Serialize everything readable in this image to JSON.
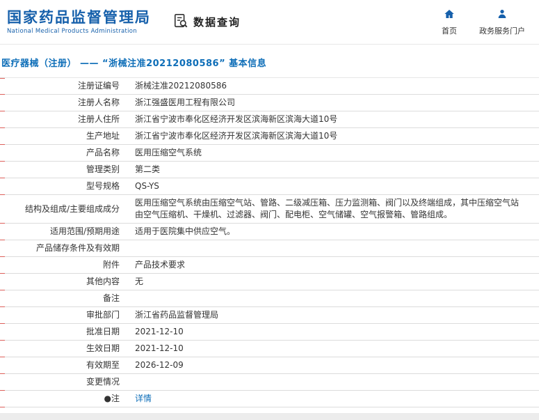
{
  "colors": {
    "brand_blue": "#1660ab",
    "title_blue": "#0e6eb8",
    "link_blue": "#0e6eb8",
    "border_gray": "#dcdcdc",
    "tick_red": "#dd5f5a",
    "text_dark": "#333333"
  },
  "header": {
    "site_name": "国家药品监督管理局",
    "site_name_en": "National Medical Products Administration",
    "section_label": "数据查询",
    "section_icon": "data-search-icon",
    "nav": [
      {
        "label": "首页",
        "icon": "home-icon"
      },
      {
        "label": "政务服务门户",
        "icon": "user-icon"
      }
    ]
  },
  "title_bar": {
    "text": "医疗器械（注册） —— “浙械注准20212080586” 基本信息"
  },
  "table": {
    "rows": [
      {
        "label": "注册证编号",
        "value": "浙械注准20212080586"
      },
      {
        "label": "注册人名称",
        "value": "浙江强盛医用工程有限公司"
      },
      {
        "label": "注册人住所",
        "value": "浙江省宁波市奉化区经济开发区滨海新区滨海大道10号"
      },
      {
        "label": "生产地址",
        "value": "浙江省宁波市奉化区经济开发区滨海新区滨海大道10号"
      },
      {
        "label": "产品名称",
        "value": "医用压缩空气系统"
      },
      {
        "label": "管理类别",
        "value": "第二类"
      },
      {
        "label": "型号规格",
        "value": "QS-YS"
      },
      {
        "label": "结构及组成/主要组成成分",
        "value": "医用压缩空气系统由压缩空气站、管路、二级减压箱、压力监测箱、阀门以及终端组成，其中压缩空气站由空气压缩机、干燥机、过滤器、阀门、配电柜、空气储罐、空气报警箱、管路组成。"
      },
      {
        "label": "适用范围/预期用途",
        "value": "适用于医院集中供应空气。"
      },
      {
        "label": "产品储存条件及有效期",
        "value": ""
      },
      {
        "label": "附件",
        "value": "产品技术要求"
      },
      {
        "label": "其他内容",
        "value": "无"
      },
      {
        "label": "备注",
        "value": ""
      },
      {
        "label": "审批部门",
        "value": "浙江省药品监督管理局"
      },
      {
        "label": "批准日期",
        "value": "2021-12-10"
      },
      {
        "label": "生效日期",
        "value": "2021-12-10"
      },
      {
        "label": "有效期至",
        "value": "2026-12-09"
      },
      {
        "label": "变更情况",
        "value": ""
      },
      {
        "label": "●注",
        "value": "详情",
        "link": true
      }
    ]
  }
}
